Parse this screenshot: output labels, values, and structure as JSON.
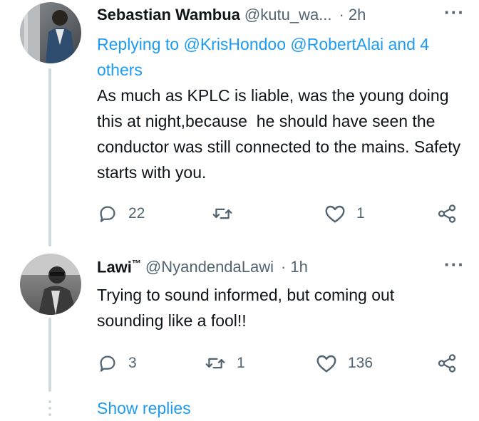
{
  "tweets": [
    {
      "name": "Sebastian Wambua",
      "handle": "@kutu_wa...",
      "sep": "·",
      "time": "2h",
      "replying_label": "Replying to",
      "replying_to": "@KrisHondoo @RobertAlai and 4 others",
      "text": "As much as KPLC is liable, was the young doing this at night,because  he should have seen the conductor was still connected to the mains. Safety starts with you.",
      "replies": "22",
      "retweets": "",
      "likes": "1"
    },
    {
      "name": "Lawi",
      "name_suffix": "™",
      "handle": "@NyandendaLawi",
      "sep": "·",
      "time": "1h",
      "text": "Trying to sound informed, but coming out sounding like a fool!!",
      "replies": "3",
      "retweets": "1",
      "likes": "136"
    }
  ],
  "show_replies": "Show replies",
  "colors": {
    "link": "#1d9bf0",
    "muted": "#536471",
    "thread_line": "#cfd9de"
  },
  "icons": [
    "more-icon",
    "reply-icon",
    "retweet-icon",
    "like-icon",
    "share-icon"
  ]
}
